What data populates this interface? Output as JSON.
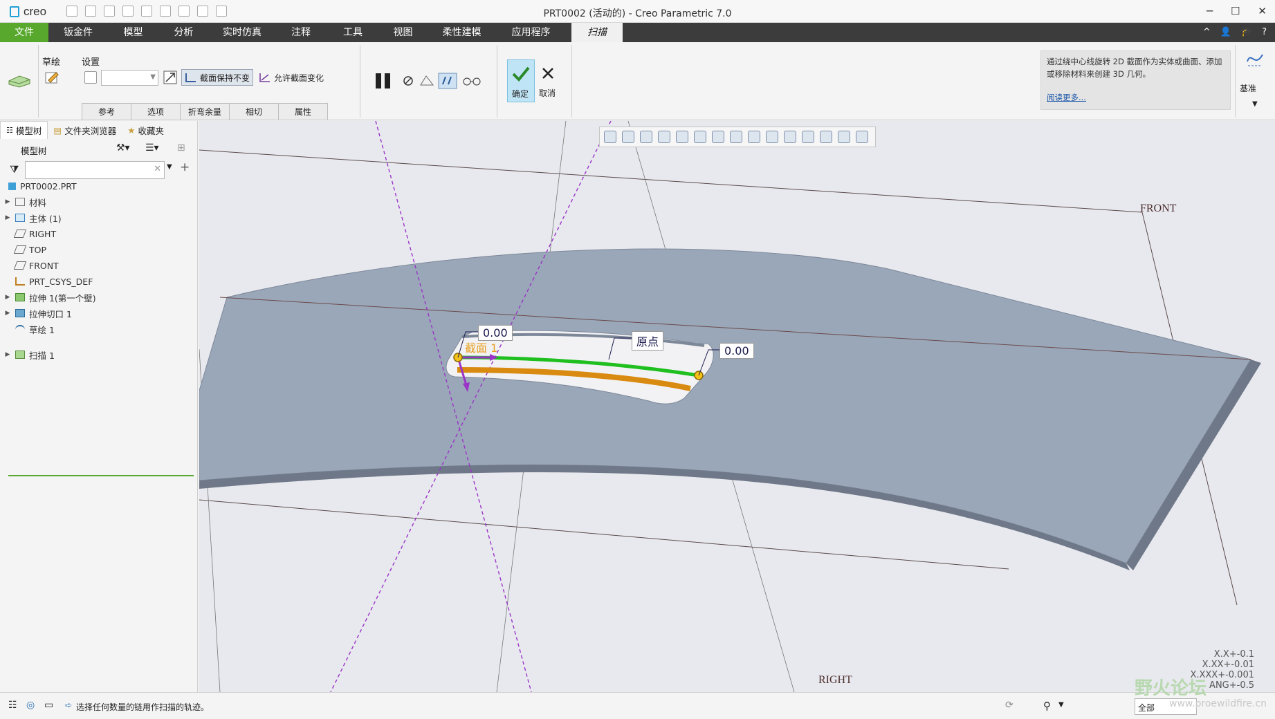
{
  "app": {
    "logo_text": "creo",
    "window_title": "PRT0002 (活动的) - Creo Parametric 7.0",
    "controls": [
      "─",
      "☐",
      "✕"
    ]
  },
  "menu": {
    "tabs": [
      "文件",
      "钣金件",
      "模型",
      "分析",
      "实时仿真",
      "注释",
      "工具",
      "视图",
      "柔性建模",
      "应用程序",
      "扫描"
    ],
    "active_tab": "扫描",
    "right_icons": [
      "^",
      "👤",
      "🎓",
      "?"
    ]
  },
  "ribbon": {
    "sketch_label": "草绘",
    "settings_label": "设置",
    "keep_section": "截面保持不变",
    "allow_section_change": "允许截面变化",
    "subtabs": [
      "参考",
      "选项",
      "折弯余量",
      "相切",
      "属性"
    ],
    "ok_label": "确定",
    "cancel_label": "取消",
    "info_text": "通过绕中心线旋转 2D 截面作为实体或曲面、添加或移除材料来创建 3D 几何。",
    "info_link": "阅读更多...",
    "datum_label": "基准"
  },
  "left_panel": {
    "tabs": [
      "模型树",
      "文件夹浏览器",
      "收藏夹"
    ],
    "tree_title": "模型树",
    "items": [
      {
        "label": "PRT0002.PRT",
        "expand": false
      },
      {
        "label": "材料",
        "expand": true
      },
      {
        "label": "主体 (1)",
        "expand": true
      },
      {
        "label": "RIGHT",
        "expand": false
      },
      {
        "label": "TOP",
        "expand": false
      },
      {
        "label": "FRONT",
        "expand": false
      },
      {
        "label": "PRT_CSYS_DEF",
        "expand": false
      },
      {
        "label": "拉伸 1(第一个壁)",
        "expand": true
      },
      {
        "label": "拉伸切口 1",
        "expand": true
      },
      {
        "label": "草绘 1",
        "expand": false
      },
      {
        "label": "扫描 1",
        "expand": true
      }
    ]
  },
  "viewport": {
    "plane_front": "FRONT",
    "plane_right": "RIGHT",
    "dim_left": "0.00",
    "dim_right": "0.00",
    "origin_label": "原点",
    "section_label": "截面 1",
    "tolerances": [
      "X.X+-0.1",
      "X.XX+-0.01",
      "X.XXX+-0.001",
      "ANG+-0.5"
    ],
    "colors": {
      "trajectory": "#1fbf1f",
      "chain": "#d98a10",
      "axis": "#9b33c8",
      "body": "#9aa7b8"
    }
  },
  "status": {
    "message": "选择任何数量的链用作扫描的轨迹。",
    "filter_value": "全部"
  },
  "watermark": {
    "text": "野火论坛",
    "sub": "www.proewildfire.cn"
  }
}
